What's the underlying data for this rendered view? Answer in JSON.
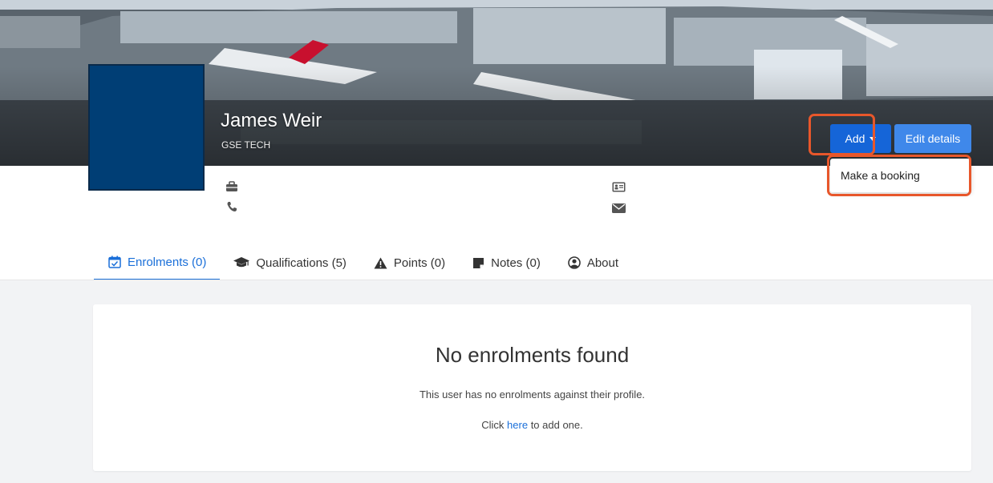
{
  "profile": {
    "name": "James Weir",
    "role": "GSE TECH"
  },
  "actions": {
    "add_label": "Add",
    "edit_label": "Edit details",
    "dropdown_items": [
      "Make a booking"
    ]
  },
  "info_icons": [
    "briefcase-icon",
    "phone-icon",
    "id-card-icon",
    "envelope-icon"
  ],
  "tabs": [
    {
      "label": "Enrolments (0)",
      "icon": "calendar-check-icon",
      "active": true
    },
    {
      "label": "Qualifications (5)",
      "icon": "graduation-cap-icon",
      "active": false
    },
    {
      "label": "Points (0)",
      "icon": "warning-icon",
      "active": false
    },
    {
      "label": "Notes (0)",
      "icon": "note-icon",
      "active": false
    },
    {
      "label": "About",
      "icon": "user-circle-icon",
      "active": false
    }
  ],
  "empty_state": {
    "title": "No enrolments found",
    "message": "This user has no enrolments against their profile.",
    "click_prefix": "Click",
    "link_text": "here",
    "click_suffix": "to add one."
  },
  "colors": {
    "primary": "#1565d8",
    "primary_light": "#3f88ea",
    "avatar": "#003e75",
    "highlight": "#e8572b",
    "link": "#1a6fd9"
  }
}
